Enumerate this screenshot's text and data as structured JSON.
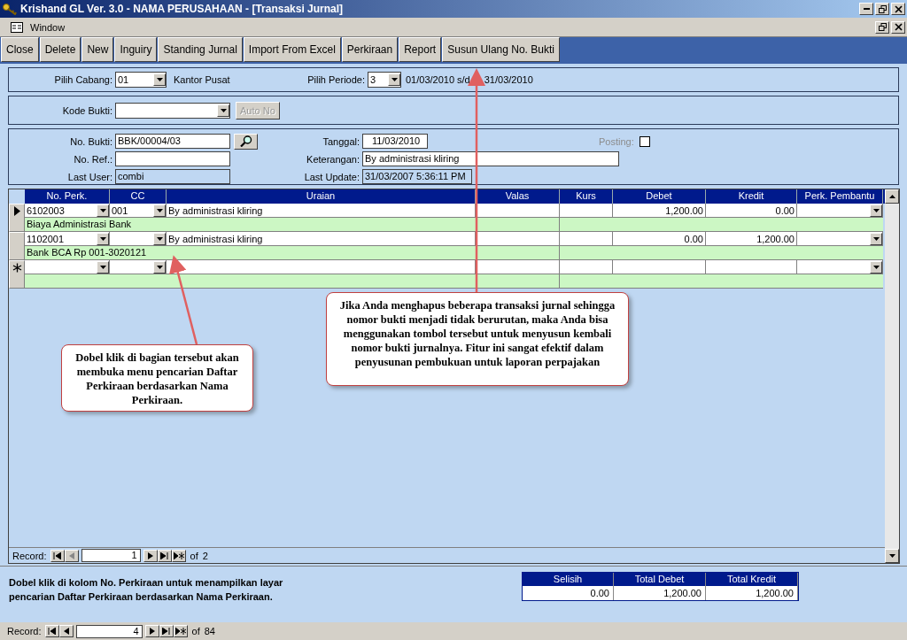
{
  "window": {
    "title": "Krishand GL Ver. 3.0 - NAMA PERUSAHAAN - [Transaksi Jurnal]"
  },
  "menu": [
    "Window"
  ],
  "toolbar": [
    "Close",
    "Delete",
    "New",
    "Inguiry",
    "Standing Jurnal",
    "Import From Excel",
    "Perkiraan",
    "Report",
    "Susun Ulang No. Bukti"
  ],
  "cabang": {
    "label": "Pilih Cabang:",
    "value": "01",
    "name": "Kantor Pusat"
  },
  "periode": {
    "label": "Pilih Periode:",
    "value": "3",
    "from": "01/03/2010",
    "separator": "s/d",
    "to": "31/03/2010"
  },
  "kode_bukti": {
    "label": "Kode Bukti:",
    "button": "Auto No",
    "button_disabled": true
  },
  "header": {
    "no_bukti": {
      "label": "No. Bukti:",
      "value": "BBK/00004/03"
    },
    "no_ref": {
      "label": "No. Ref.:"
    },
    "last_user": {
      "label": "Last User:",
      "value": "combi"
    },
    "tanggal": {
      "label": "Tanggal:",
      "value": "11/03/2010"
    },
    "keterangan": {
      "label": "Keterangan:",
      "value": "By administrasi kliring"
    },
    "last_update": {
      "label": "Last Update:",
      "value": "31/03/2007 5:36:11 PM"
    },
    "posting": {
      "label": "Posting:",
      "disabled": true,
      "checked": false
    }
  },
  "grid": {
    "columns": [
      {
        "label": "No. Perk.",
        "kind": "combo"
      },
      {
        "label": "CC",
        "kind": "combo"
      },
      {
        "label": "Uraian",
        "kind": "text"
      },
      {
        "label": "Valas",
        "kind": "number"
      },
      {
        "label": "Kurs",
        "kind": "number"
      },
      {
        "label": "Debet",
        "kind": "number"
      },
      {
        "label": "Kredit",
        "kind": "number"
      },
      {
        "label": "Perk. Pembantu",
        "kind": "combo"
      }
    ],
    "rows": [
      {
        "kind": "record",
        "selected": true,
        "no_perk": "6102003",
        "cc": "001",
        "uraian": "By administrasi kliring",
        "debet": "1,200.00",
        "kredit": "0.00",
        "nama_perkiraan": "Biaya Administrasi Bank"
      },
      {
        "kind": "record",
        "selected": false,
        "no_perk": "1102001",
        "uraian": "By administrasi kliring",
        "debet": "0.00",
        "kredit": "1,200.00",
        "nama_perkiraan": "Bank BCA Rp 001-3020121"
      },
      {
        "kind": "new",
        "selected": false
      }
    ],
    "record_nav": {
      "label": "Record:",
      "value": "1",
      "of": "of",
      "total": "2"
    }
  },
  "footer_note": "Dobel klik di kolom No. Perkiraan untuk menampilkan layar pencarian Daftar Perkiraan berdasarkan Nama Perkiraan.",
  "totals": {
    "columns": [
      "Selisih",
      "Total Debet",
      "Total Kredit"
    ],
    "values": [
      "0.00",
      "1,200.00",
      "1,200.00"
    ]
  },
  "record_nav": {
    "label": "Record:",
    "value": "4",
    "of": "of",
    "total": "84"
  },
  "callouts": [
    {
      "text": "Jika Anda menghapus beberapa transaksi jurnal sehingga nomor bukti menjadi tidak berurutan, maka Anda bisa menggunakan tombol tersebut untuk menyusun kembali nomor bukti jurnalnya. Fitur ini sangat efektif dalam penyusunan pembukuan untuk laporan perpajakan"
    },
    {
      "text": "Dobel klik di bagian tersebut akan membuka menu pencarian Daftar Perkiraan berdasarkan Nama Perkiraan."
    }
  ]
}
